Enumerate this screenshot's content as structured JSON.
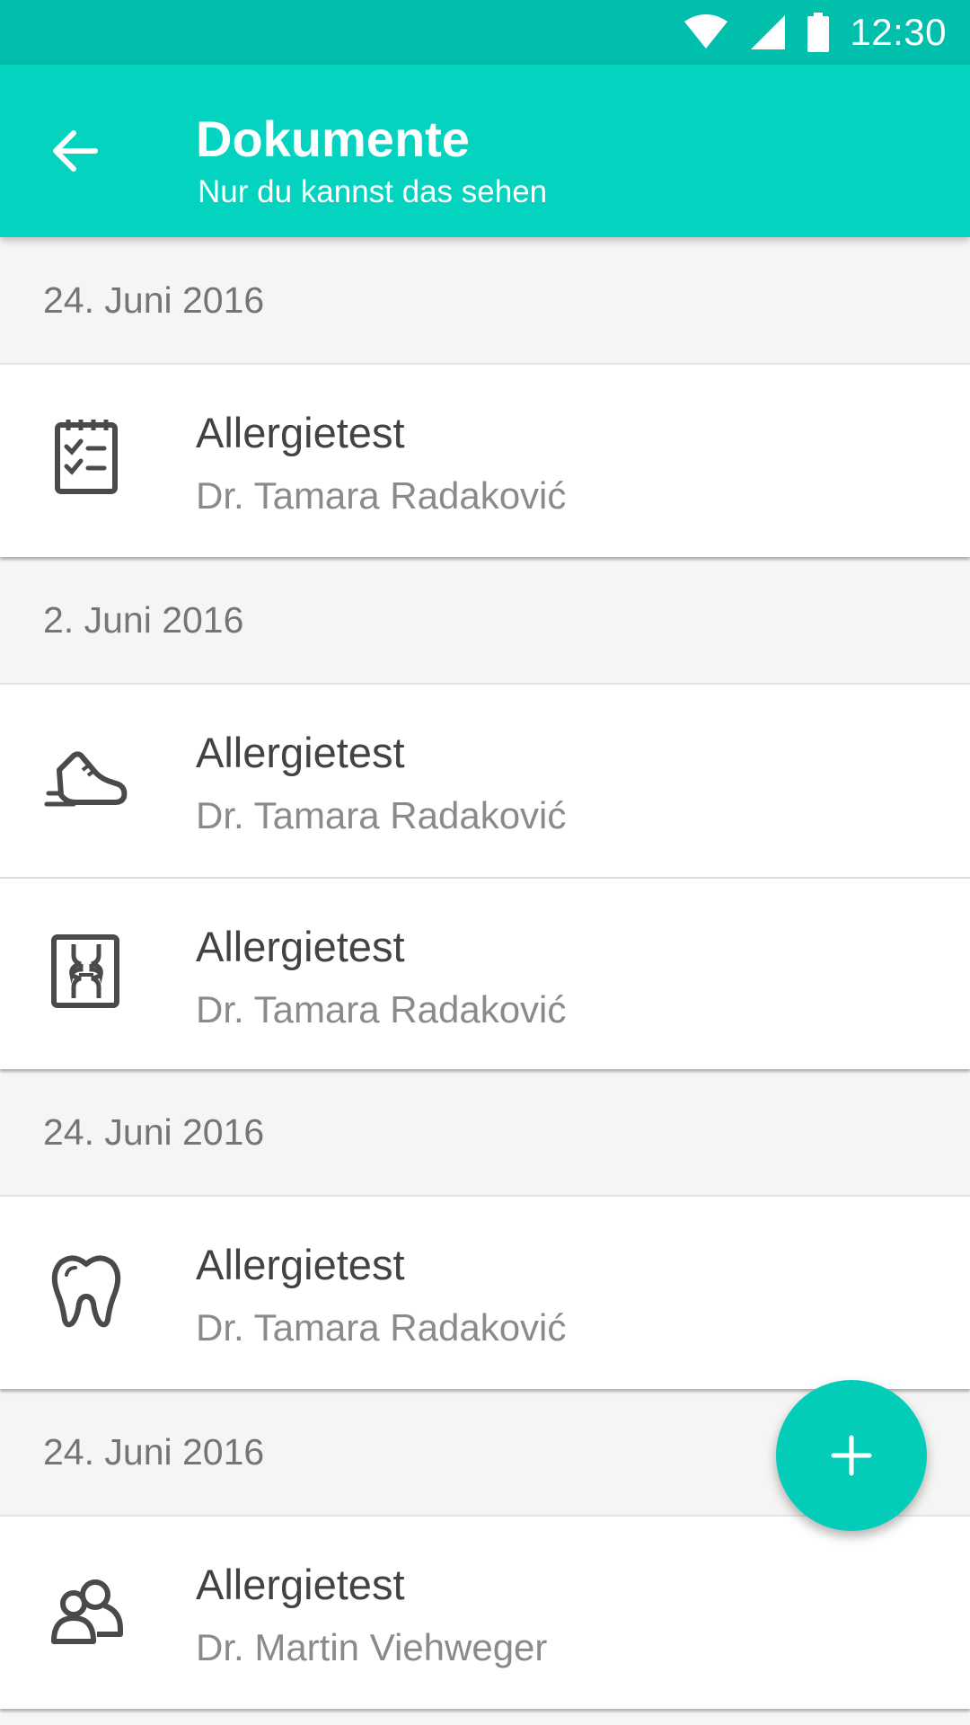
{
  "status_bar": {
    "time": "12:30",
    "icons": [
      "wifi-icon",
      "signal-icon",
      "battery-icon"
    ]
  },
  "toolbar": {
    "back_icon": "arrow-left-icon",
    "title": "Dokumente",
    "subtitle": "Nur du kannst das sehen"
  },
  "sections": [
    {
      "date": "24. Juni 2016",
      "items": [
        {
          "icon": "checklist-clipboard-icon",
          "title": "Allergietest",
          "doctor": "Dr. Tamara Radaković"
        }
      ]
    },
    {
      "date": "2. Juni 2016",
      "items": [
        {
          "icon": "running-shoe-icon",
          "title": "Allergietest",
          "doctor": "Dr. Tamara Radaković"
        },
        {
          "icon": "xray-bone-icon",
          "title": "Allergietest",
          "doctor": "Dr. Tamara Radaković"
        }
      ]
    },
    {
      "date": "24. Juni 2016",
      "items": [
        {
          "icon": "tooth-icon",
          "title": "Allergietest",
          "doctor": "Dr. Tamara Radaković"
        }
      ]
    },
    {
      "date": "24. Juni 2016",
      "items": [
        {
          "icon": "group-people-icon",
          "title": "Allergietest",
          "doctor": "Dr. Martin Viehweger"
        }
      ]
    }
  ],
  "fab": {
    "icon": "plus-icon"
  },
  "colors": {
    "status_bar": "#00bfad",
    "toolbar": "#03d3bf",
    "accent": "#03cdb9",
    "icon": "#4a4a4a"
  }
}
